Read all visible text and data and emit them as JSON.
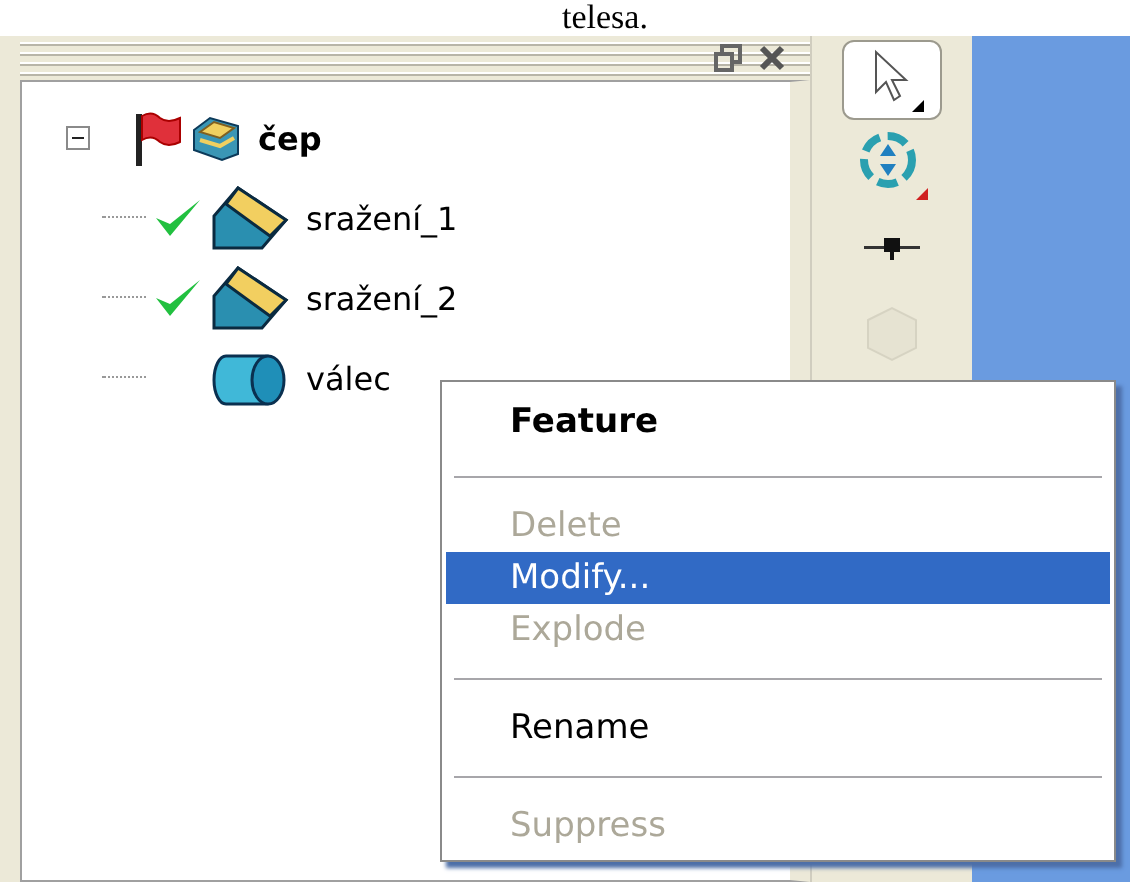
{
  "caption": "telesa.",
  "panel": {
    "tree": {
      "label": "čep",
      "expanded": true,
      "children": [
        {
          "label": "sražení_1",
          "kind": "chamfer",
          "valid": true
        },
        {
          "label": "sražení_2",
          "kind": "chamfer",
          "valid": true
        },
        {
          "label": "válec",
          "kind": "cylinder",
          "valid": false
        }
      ]
    }
  },
  "toolbar": [
    {
      "kind": "pointer",
      "selected": true,
      "disabled": false
    },
    {
      "kind": "rotate",
      "selected": false,
      "disabled": false
    },
    {
      "kind": "pin",
      "selected": false,
      "disabled": false
    },
    {
      "kind": "part",
      "selected": false,
      "disabled": true
    }
  ],
  "context_menu": {
    "items": [
      {
        "kind": "header",
        "label": "Feature"
      },
      {
        "kind": "separator"
      },
      {
        "kind": "item",
        "label": "Delete",
        "disabled": true,
        "selected": false
      },
      {
        "kind": "item",
        "label": "Modify...",
        "disabled": false,
        "selected": true
      },
      {
        "kind": "item",
        "label": "Explode",
        "disabled": true,
        "selected": false
      },
      {
        "kind": "separator"
      },
      {
        "kind": "item",
        "label": "Rename",
        "disabled": false,
        "selected": false
      },
      {
        "kind": "separator"
      },
      {
        "kind": "item",
        "label": "Suppress",
        "disabled": true,
        "selected": false
      }
    ]
  }
}
